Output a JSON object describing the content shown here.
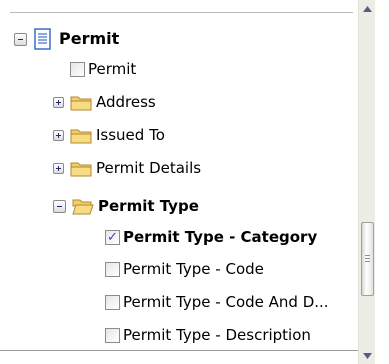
{
  "tree": {
    "root": {
      "label": "Permit",
      "icon": "document-icon",
      "expanded": true
    },
    "items": [
      {
        "kind": "checkbox",
        "label": "Permit",
        "checked": false
      },
      {
        "kind": "folder",
        "label": "Address",
        "expanded": false
      },
      {
        "kind": "folder",
        "label": "Issued To",
        "expanded": false
      },
      {
        "kind": "folder",
        "label": "Permit Details",
        "expanded": false
      },
      {
        "kind": "folder",
        "label": "Permit Type",
        "expanded": true
      },
      {
        "kind": "checkbox",
        "label": "Permit Type - Category",
        "checked": true
      },
      {
        "kind": "checkbox",
        "label": "Permit Type - Code",
        "checked": false
      },
      {
        "kind": "checkbox",
        "label": "Permit Type - Code And D...",
        "checked": false
      },
      {
        "kind": "checkbox",
        "label": "Permit Type - Description",
        "checked": false
      }
    ]
  },
  "scrollbar": {
    "position": 0.62
  },
  "colors": {
    "check": "#2b4ea8",
    "folder": "#f2cf6a",
    "document": "#3b6fc4"
  }
}
